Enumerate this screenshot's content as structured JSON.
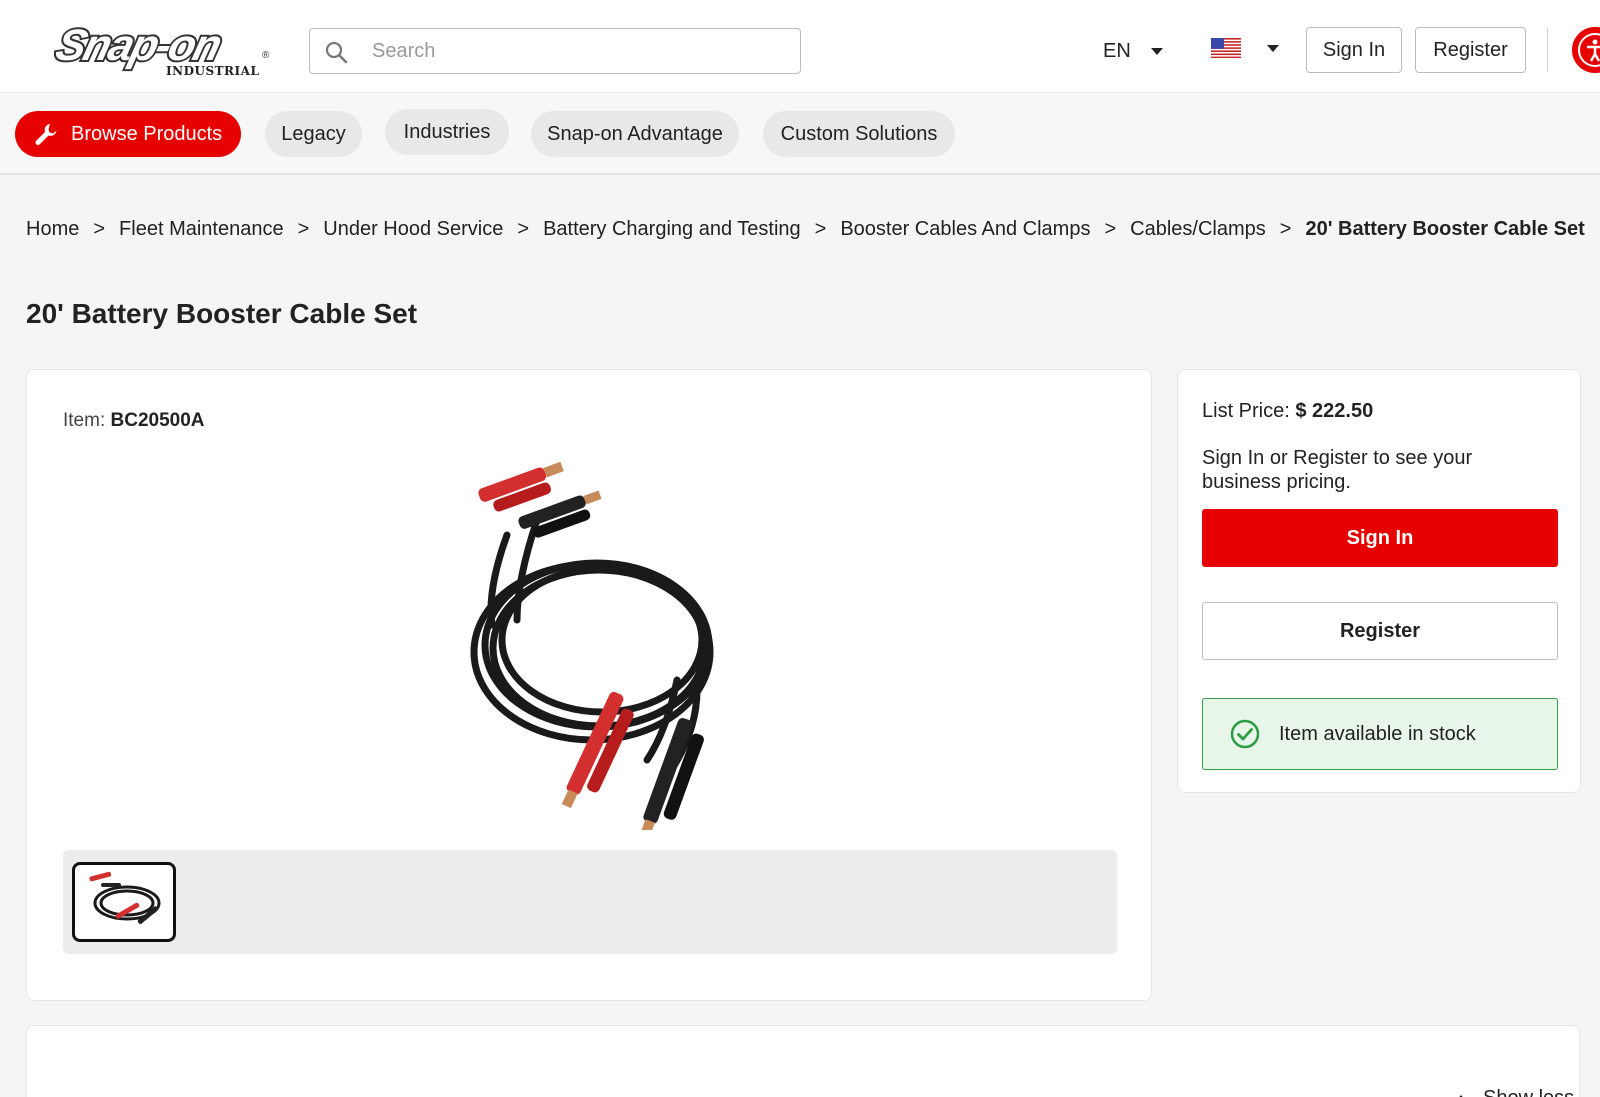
{
  "header": {
    "logo_text": "Snap-on",
    "logo_subtext": "INDUSTRIAL",
    "search_placeholder": "Search",
    "language": "EN",
    "sign_in_label": "Sign In",
    "register_label": "Register"
  },
  "nav": {
    "items": [
      {
        "label": "Browse Products",
        "active": true
      },
      {
        "label": "Legacy"
      },
      {
        "label": "Industries"
      },
      {
        "label": "Snap-on Advantage"
      },
      {
        "label": "Custom Solutions"
      }
    ]
  },
  "breadcrumb": {
    "separator": ">",
    "items": [
      "Home",
      "Fleet Maintenance",
      "Under Hood Service",
      "Battery Charging and Testing",
      "Booster Cables And Clamps",
      "Cables/Clamps",
      "20' Battery Booster Cable Set"
    ]
  },
  "product": {
    "title": "20' Battery Booster Cable Set",
    "item_label": "Item:",
    "item_number": "BC20500A"
  },
  "pricing": {
    "list_price_label": "List Price:",
    "list_price_value": "$ 222.50",
    "note": "Sign In or Register to see your business pricing.",
    "sign_in_label": "Sign In",
    "register_label": "Register",
    "stock_text": "Item available in stock"
  },
  "details": {
    "toggle_label": "Show less"
  },
  "colors": {
    "brand_red": "#e60000",
    "stock_green": "#2e9e44",
    "stock_bg": "#e8f5e9"
  }
}
